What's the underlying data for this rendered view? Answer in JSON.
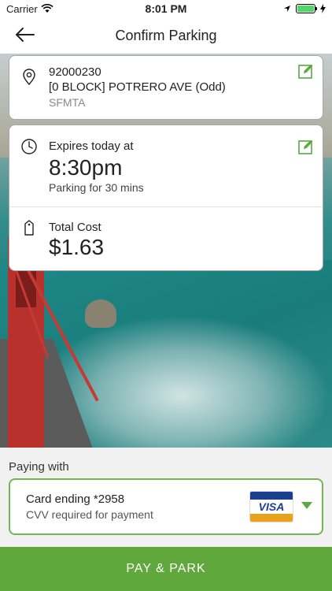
{
  "status_bar": {
    "carrier": "Carrier",
    "time": "8:01 PM"
  },
  "header": {
    "title": "Confirm Parking",
    "back_icon": "back-arrow-icon"
  },
  "location": {
    "zone": "92000230",
    "address": "[0 BLOCK] POTRERO AVE (Odd)",
    "agency": "SFMTA",
    "icon": "location-pin-icon"
  },
  "parking": {
    "expires_label": "Expires today at",
    "expires_time": "8:30pm",
    "duration": "Parking for 30 mins",
    "total_label": "Total Cost",
    "total_value": "$1.63"
  },
  "payment": {
    "paying_label": "Paying with",
    "card_label": "Card ending *2958",
    "cvv_note": "CVV required for payment",
    "brand": "VISA"
  },
  "cta": {
    "label": "PAY & PARK"
  },
  "colors": {
    "accent": "#61a83c",
    "accent_border": "#73b557"
  }
}
